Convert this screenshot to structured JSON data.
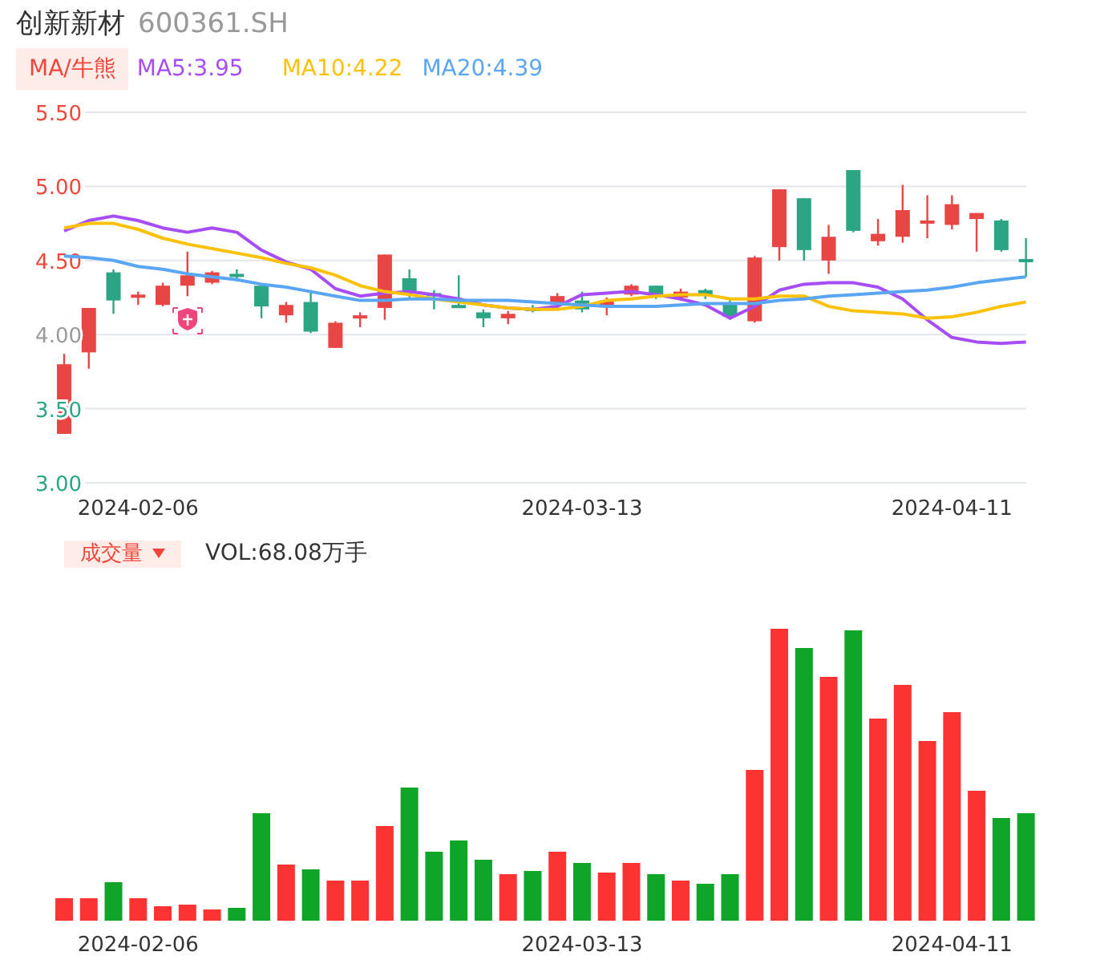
{
  "stock": {
    "name": "创新新材",
    "code": "600361.SH"
  },
  "legend": {
    "button": "MA/牛熊"
  },
  "price_chart": {
    "chart_data": {
      "type": "candlestick",
      "grid": true,
      "ylim": [
        3.0,
        5.5
      ],
      "categories": [
        null,
        null,
        null,
        "2024-02-06",
        null,
        null,
        null,
        null,
        null,
        null,
        null,
        null,
        null,
        null,
        null,
        null,
        null,
        null,
        null,
        null,
        null,
        "2024-03-13",
        null,
        null,
        null,
        null,
        null,
        null,
        null,
        null,
        null,
        null,
        null,
        null,
        null,
        null,
        "2024-04-11",
        null,
        null,
        null
      ],
      "yticks": [
        {
          "value": 5.5,
          "label": "5.50"
        },
        {
          "value": 5.0,
          "label": "5.00"
        },
        {
          "value": 4.5,
          "label": "4.50"
        },
        {
          "value": 4.0,
          "label": "4.00"
        },
        {
          "value": 3.5,
          "label": "3.50"
        },
        {
          "value": 3.0,
          "label": "3.00"
        }
      ],
      "ohlc": [
        [
          3.33,
          3.87,
          3.33,
          3.8
        ],
        [
          3.88,
          4.18,
          3.77,
          4.18
        ],
        [
          4.42,
          4.44,
          4.14,
          4.23
        ],
        [
          4.25,
          4.29,
          4.2,
          4.27
        ],
        [
          4.2,
          4.35,
          4.19,
          4.33
        ],
        [
          4.33,
          4.56,
          4.26,
          4.4
        ],
        [
          4.35,
          4.43,
          4.34,
          4.42
        ],
        [
          4.41,
          4.44,
          4.36,
          4.4
        ],
        [
          4.33,
          4.33,
          4.11,
          4.19
        ],
        [
          4.13,
          4.22,
          4.08,
          4.2
        ],
        [
          4.22,
          4.3,
          4.01,
          4.02
        ],
        [
          3.91,
          4.09,
          3.91,
          4.08
        ],
        [
          4.12,
          4.15,
          4.05,
          4.13
        ],
        [
          4.18,
          4.54,
          4.1,
          4.54
        ],
        [
          4.38,
          4.44,
          4.25,
          4.28
        ],
        [
          4.28,
          4.3,
          4.17,
          4.26
        ],
        [
          4.2,
          4.4,
          4.18,
          4.19
        ],
        [
          4.15,
          4.17,
          4.05,
          4.11
        ],
        [
          4.11,
          4.16,
          4.07,
          4.14
        ],
        [
          4.18,
          4.2,
          4.15,
          4.17
        ],
        [
          4.2,
          4.28,
          4.18,
          4.26
        ],
        [
          4.23,
          4.29,
          4.15,
          4.17
        ],
        [
          4.19,
          4.25,
          4.13,
          4.23
        ],
        [
          4.27,
          4.34,
          4.26,
          4.33
        ],
        [
          4.33,
          4.33,
          4.24,
          4.26
        ],
        [
          4.25,
          4.31,
          4.23,
          4.29
        ],
        [
          4.3,
          4.31,
          4.24,
          4.27
        ],
        [
          4.21,
          4.25,
          4.1,
          4.12
        ],
        [
          4.09,
          4.53,
          4.08,
          4.52
        ],
        [
          4.59,
          4.98,
          4.5,
          4.98
        ],
        [
          4.92,
          4.92,
          4.5,
          4.57
        ],
        [
          4.5,
          4.74,
          4.41,
          4.66
        ],
        [
          5.11,
          5.11,
          4.69,
          4.7
        ],
        [
          4.63,
          4.78,
          4.6,
          4.68
        ],
        [
          4.66,
          5.01,
          4.62,
          4.84
        ],
        [
          4.75,
          4.94,
          4.65,
          4.77
        ],
        [
          4.74,
          4.94,
          4.71,
          4.88
        ],
        [
          4.78,
          4.82,
          4.56,
          4.82
        ],
        [
          4.77,
          4.78,
          4.56,
          4.57
        ],
        [
          4.51,
          4.65,
          4.39,
          4.5
        ]
      ],
      "series": [
        {
          "name": "MA5:3.95",
          "type": "line",
          "color": "#a64df5",
          "values": [
            4.7,
            4.77,
            4.8,
            4.77,
            4.72,
            4.69,
            4.72,
            4.69,
            4.57,
            4.49,
            4.44,
            4.31,
            4.26,
            4.28,
            4.29,
            4.27,
            4.24,
            4.2,
            4.18,
            4.17,
            4.19,
            4.27,
            4.28,
            4.29,
            4.27,
            4.24,
            4.2,
            4.11,
            4.19,
            4.3,
            4.34,
            4.35,
            4.35,
            4.32,
            4.24,
            4.1,
            3.98,
            3.95,
            3.94,
            3.95
          ]
        },
        {
          "name": "MA10:4.22",
          "type": "line",
          "color": "#fcc10a",
          "values": [
            4.72,
            4.75,
            4.75,
            4.71,
            4.65,
            4.61,
            4.58,
            4.55,
            4.52,
            4.48,
            4.45,
            4.4,
            4.33,
            4.29,
            4.27,
            4.24,
            4.22,
            4.2,
            4.18,
            4.17,
            4.17,
            4.19,
            4.23,
            4.24,
            4.26,
            4.27,
            4.27,
            4.24,
            4.24,
            4.26,
            4.26,
            4.19,
            4.16,
            4.15,
            4.14,
            4.11,
            4.12,
            4.15,
            4.19,
            4.22
          ]
        },
        {
          "name": "MA20:4.39",
          "type": "line",
          "color": "#5aa6f2",
          "values": [
            4.53,
            4.52,
            4.5,
            4.46,
            4.44,
            4.41,
            4.39,
            4.37,
            4.34,
            4.32,
            4.29,
            4.26,
            4.23,
            4.23,
            4.24,
            4.24,
            4.23,
            4.23,
            4.23,
            4.22,
            4.21,
            4.2,
            4.19,
            4.19,
            4.19,
            4.2,
            4.21,
            4.21,
            4.21,
            4.23,
            4.24,
            4.26,
            4.27,
            4.28,
            4.29,
            4.3,
            4.32,
            4.35,
            4.37,
            4.39
          ]
        }
      ]
    }
  },
  "volume": {
    "button": "成交量",
    "reading": "VOL:68.08万手",
    "dates": [
      "2024-02-06",
      "2024-03-13",
      "2024-04-11"
    ]
  }
}
